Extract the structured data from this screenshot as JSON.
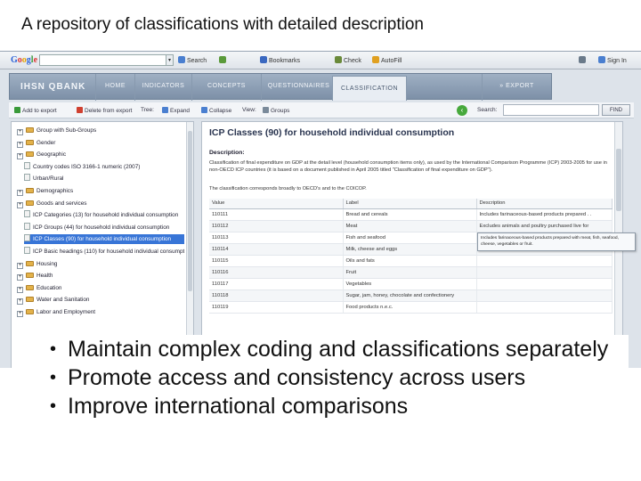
{
  "slide_title": "A repository of classifications with detailed description",
  "google_bar": {
    "logo": [
      "G",
      "o",
      "o",
      "g",
      "l",
      "e"
    ],
    "search_drop": "▾",
    "search_label": "Search",
    "bookmarks_label": "Bookmarks",
    "check_label": "Check",
    "autofill_label": "AutoFill",
    "signin_label": "Sign In"
  },
  "app": {
    "brand": "IHSN QBANK",
    "tabs": [
      {
        "label": "HOME"
      },
      {
        "label": "INDICATORS"
      },
      {
        "label": "CONCEPTS"
      },
      {
        "label": "QUESTIONNAIRES"
      },
      {
        "label": "CLASSIFICATION"
      }
    ],
    "export_tab": "» EXPORT"
  },
  "toolbar": {
    "add_to_export": "Add to export",
    "delete_from_export": "Delete from export",
    "tree_label": "Tree:",
    "expand": "Expand",
    "collapse": "Collapse",
    "view_label": "View:",
    "groups": "Groups",
    "search_label": "Search:",
    "find": "FIND"
  },
  "tree": {
    "nodes": [
      {
        "label": "Group with Sub-Groups",
        "kind": "group",
        "level": 0
      },
      {
        "label": "Gender",
        "kind": "group",
        "level": 0
      },
      {
        "label": "Geographic",
        "kind": "group",
        "level": 0
      },
      {
        "label": "Country codes ISO 3166-1 numeric (2007)",
        "kind": "leaf",
        "level": 1
      },
      {
        "label": "Urban/Rural",
        "kind": "leaf",
        "level": 1
      },
      {
        "label": "Demographics",
        "kind": "group",
        "level": 0
      },
      {
        "label": "Goods and services",
        "kind": "group",
        "level": 0
      },
      {
        "label": "ICP Categories (13) for household individual consumption",
        "kind": "leaf",
        "level": 1
      },
      {
        "label": "ICP Groups (44) for household individual consumption",
        "kind": "leaf",
        "level": 1
      },
      {
        "label": "ICP Classes (90) for household individual consumption",
        "kind": "leaf",
        "level": 1,
        "selected": true
      },
      {
        "label": "ICP Basic headings (110) for household individual consumption",
        "kind": "leaf",
        "level": 1
      },
      {
        "label": "Housing",
        "kind": "group",
        "level": 0
      },
      {
        "label": "Health",
        "kind": "group",
        "level": 0
      },
      {
        "label": "Education",
        "kind": "group",
        "level": 0
      },
      {
        "label": "Water and Sanitation",
        "kind": "group",
        "level": 0
      },
      {
        "label": "Labor and Employment",
        "kind": "group",
        "level": 0
      }
    ]
  },
  "detail": {
    "title": "ICP Classes (90) for household individual consumption",
    "description_label": "Description:",
    "description": "Classification of final expenditure on GDP at the detail level (household consumption items only), as used by the International Comparison Programme (ICP) 2003-2005 for use in non-OECD ICP countries (it is based on a document published in April 2005 titled \"Classification of final expenditure on GDP\").",
    "note": "The classification corresponds broadly to OECD's and to the COICOP.",
    "columns": [
      "Value",
      "Label",
      "Description"
    ],
    "rows": [
      {
        "value": "110111",
        "label": "Bread and cereals",
        "description": "Includes farinaceous-based products prepared . ."
      },
      {
        "value": "110112",
        "label": "Meat",
        "description": "Excludes animals and poultry purchased live for"
      },
      {
        "value": "110113",
        "label": "Fish and seafood",
        "description": ""
      },
      {
        "value": "110114",
        "label": "Milk, cheese and eggs",
        "description": "Includes non-dairy milk substitutes such as soy. . ."
      },
      {
        "value": "110115",
        "label": "Oils and fats",
        "description": ""
      },
      {
        "value": "110116",
        "label": "Fruit",
        "description": ""
      },
      {
        "value": "110117",
        "label": "Vegetables",
        "description": ""
      },
      {
        "value": "110118",
        "label": "Sugar, jam, honey, chocolate and confectionery",
        "description": ""
      },
      {
        "value": "110119",
        "label": "Food products n.e.c.",
        "description": ""
      }
    ],
    "tooltip": "Includes farinaceous-based products prepared with meat, fish, seafood, cheese, vegetables or fruit."
  },
  "bullets": [
    {
      "text": "Maintain complex coding and classifications separately"
    },
    {
      "text": "Promote access and consistency across users"
    },
    {
      "text": "Improve international comparisons"
    }
  ],
  "colors": {
    "selected_row": "#3875d7",
    "header_bar": "#8a9cb2",
    "go_button": "#47a93c"
  }
}
